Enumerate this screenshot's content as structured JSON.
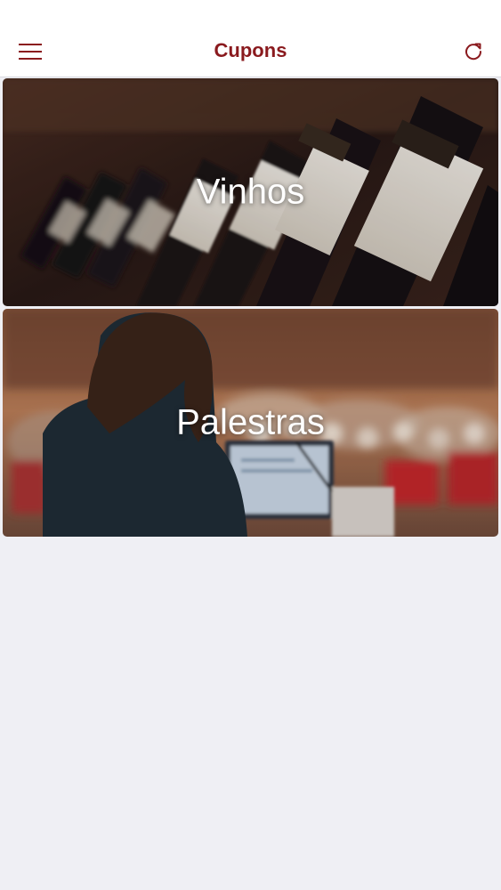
{
  "header": {
    "title": "Cupons",
    "menu_icon": "hamburger-menu-icon",
    "refresh_icon": "refresh-icon",
    "accent_color": "#8a1a1e"
  },
  "categories": [
    {
      "label": "Vinhos",
      "image": "wine-bottles-photo"
    },
    {
      "label": "Palestras",
      "image": "conference-speaker-photo"
    }
  ]
}
